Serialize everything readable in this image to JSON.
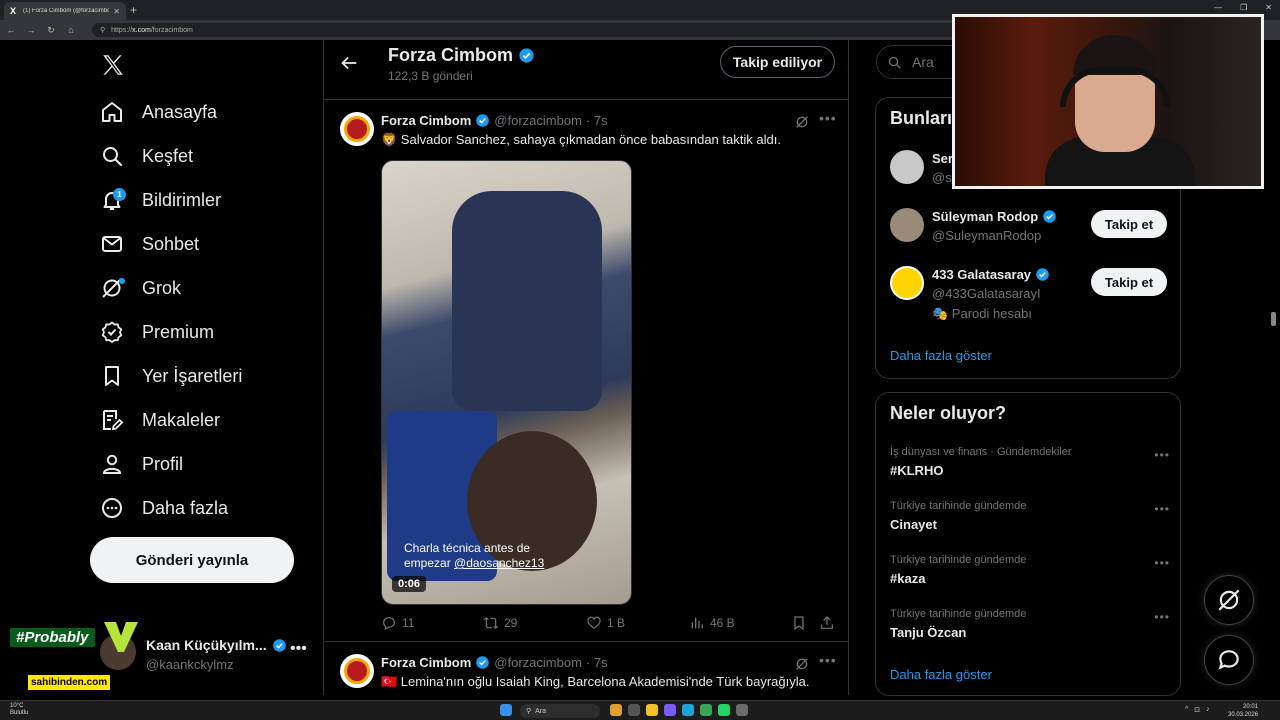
{
  "browser": {
    "tab_title": "(1) Forza Cimbom (@forzacimbom",
    "url_prefix": "https://",
    "url_domain": "x.com",
    "url_path": "/forzacimbom"
  },
  "nav": {
    "items": [
      {
        "label": "Anasayfa",
        "icon": "home-icon"
      },
      {
        "label": "Keşfet",
        "icon": "search-icon"
      },
      {
        "label": "Bildirimler",
        "icon": "bell-icon",
        "badge": "1"
      },
      {
        "label": "Sohbet",
        "icon": "mail-icon"
      },
      {
        "label": "Grok",
        "icon": "grok-icon"
      },
      {
        "label": "Premium",
        "icon": "premium-icon"
      },
      {
        "label": "Yer İşaretleri",
        "icon": "bookmark-icon"
      },
      {
        "label": "Makaleler",
        "icon": "articles-icon"
      },
      {
        "label": "Profil",
        "icon": "profile-icon"
      },
      {
        "label": "Daha fazla",
        "icon": "more-icon"
      }
    ],
    "post_button": "Gönderi yayınla"
  },
  "account": {
    "name": "Kaan Küçükyılm...",
    "handle": "@kaankckylmz"
  },
  "overlay": {
    "probably": "#Probably",
    "sahibinden": "sahibinden.com"
  },
  "profile_header": {
    "name": "Forza Cimbom",
    "posts_count": "122,3 B gönderi",
    "following_label": "Takip ediliyor"
  },
  "tweets": [
    {
      "name": "Forza Cimbom",
      "handle": "@forzacimbom",
      "time": "· 7s",
      "text": "🦁 Salvador Sanchez, sahaya çıkmadan önce babasından taktik aldı.",
      "caption_line1": "Charla técnica antes de",
      "caption_line2": "empezar",
      "caption_mention": "@daosanchez13",
      "duration": "0:06",
      "replies": "11",
      "retweets": "29",
      "likes": "1 B",
      "views": "46 B"
    },
    {
      "name": "Forza Cimbom",
      "handle": "@forzacimbom",
      "time": "· 7s",
      "text": "🇹🇷 Lemina'nın oğlu Isaiah King, Barcelona Akademisi'nde Türk bayrağıyla."
    }
  ],
  "search": {
    "placeholder": "Ara"
  },
  "who_to_follow": {
    "title": "Bunları",
    "users": [
      {
        "name": "Ser",
        "handle": "@se"
      },
      {
        "name": "Süleyman Rodop",
        "handle": "@SuleymanRodop",
        "button": "Takip et"
      },
      {
        "name": "433 Galatasaray",
        "handle": "@433GalatasarayI",
        "extra": "🎭 Parodi hesabı",
        "button": "Takip et"
      }
    ],
    "show_more": "Daha fazla göster"
  },
  "trends": {
    "title": "Neler oluyor?",
    "items": [
      {
        "meta": "İş dünyası ve finans · Gündemdekiler",
        "topic": "#KLRHO"
      },
      {
        "meta": "Türkiye tarihinde gündemde",
        "topic": "Cinayet"
      },
      {
        "meta": "Türkiye tarihinde gündemde",
        "topic": "#kaza"
      },
      {
        "meta": "Türkiye tarihinde gündemde",
        "topic": "Tanju Özcan"
      }
    ],
    "show_more": "Daha fazla göster"
  },
  "taskbar": {
    "temp": "10°C",
    "weather": "Bulutlu",
    "search": "Ara",
    "time": "20:01",
    "date": "30.03.2026"
  },
  "colors": {
    "accent": "#1d9bf0",
    "background": "#000000",
    "border": "#2f3336"
  }
}
